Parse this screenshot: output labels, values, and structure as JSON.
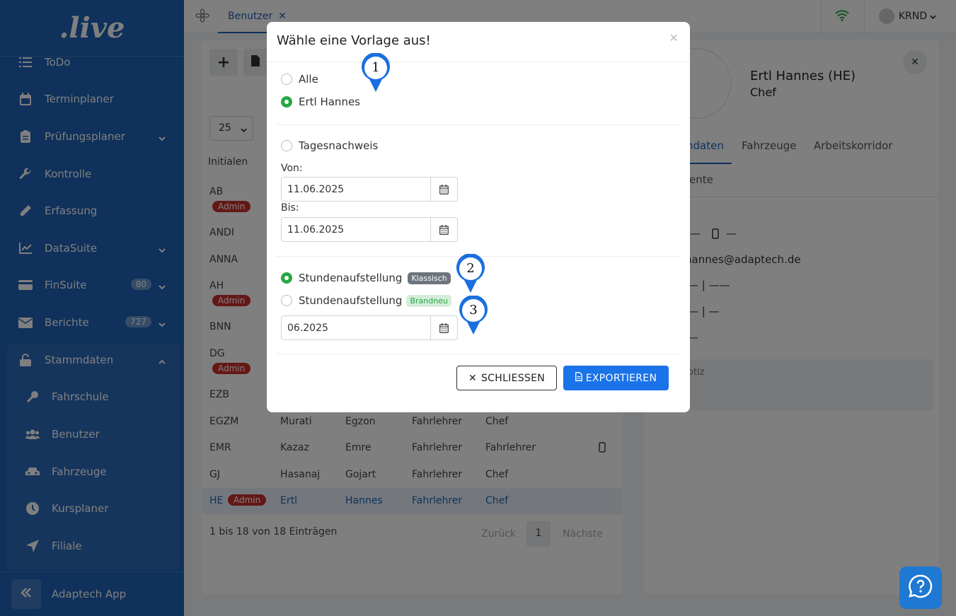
{
  "sidebar": {
    "logo": ".live",
    "items": [
      {
        "label": "ToDo",
        "icon": "list-icon"
      },
      {
        "label": "Terminplaner",
        "icon": "calendar-icon"
      },
      {
        "label": "Prüfungsplaner",
        "icon": "clipboard-icon"
      },
      {
        "label": "Kontrolle",
        "icon": "wrench-icon"
      },
      {
        "label": "Erfassung",
        "icon": "pencil-icon"
      },
      {
        "label": "DataSuite",
        "icon": "chart-line-icon"
      },
      {
        "label": "FinSuite",
        "icon": "card-icon",
        "badge": "80"
      },
      {
        "label": "Berichte",
        "icon": "envelope-icon",
        "badge": "727"
      },
      {
        "label": "Stammdaten",
        "icon": "lock-open-icon"
      }
    ],
    "sub_items": [
      {
        "label": "Fahrschule",
        "icon": "key-icon"
      },
      {
        "label": "Benutzer",
        "icon": "users-icon"
      },
      {
        "label": "Fahrzeuge",
        "icon": "car-icon"
      },
      {
        "label": "Kursplaner",
        "icon": "clock-icon"
      },
      {
        "label": "Filiale",
        "icon": "location-arrow-icon"
      }
    ],
    "footer_label": "Adaptech App"
  },
  "topbar": {
    "tab_label": "Benutzer",
    "user_label": "KRND"
  },
  "table": {
    "page_size": "25",
    "header_initials": "Initialen",
    "rows": [
      {
        "initials": "AB",
        "admin": "Admin"
      },
      {
        "initials": "ANDI"
      },
      {
        "initials": "ANNA"
      },
      {
        "initials": "AH",
        "admin": "Admin"
      },
      {
        "initials": "BNN"
      },
      {
        "initials": "DG",
        "admin": "Admin"
      },
      {
        "initials": "EZB"
      },
      {
        "initials": "EGZM",
        "last": "Murati",
        "first": "Egzon",
        "role": "Fahrlehrer",
        "position": "Chef"
      },
      {
        "initials": "EMR",
        "last": "Kazaz",
        "first": "Emre",
        "role": "Fahrlehrer",
        "position": "Fahrlehrer"
      },
      {
        "initials": "GJ",
        "last": "Hasanaj",
        "first": "Gojart",
        "role": "Fahrlehrer",
        "position": "Chef"
      },
      {
        "initials": "HE",
        "admin": "Admin",
        "last": "Ertl",
        "first": "Hannes",
        "role": "Fahrlehrer",
        "position": "Chef"
      }
    ],
    "footer_info": "1 bis 18 von 18 Einträgen",
    "prev_label": "Zurück",
    "page_number": "1",
    "next_label": "Nächste"
  },
  "detail": {
    "name": "Ertl Hannes (HE)",
    "role": "Chef",
    "tabs": [
      "ndaten",
      "Fahrzeuge",
      "Arbeitskorridor"
    ],
    "tab2": "ente",
    "dash1": "—",
    "dash2": "—",
    "email": "hannes@adaptech.de",
    "line1": "— | ——",
    "line2": "— | —",
    "line3": "—",
    "note_label": "otiz"
  },
  "modal": {
    "title": "Wähle eine Vorlage aus!",
    "opt_all": "Alle",
    "opt_user": "Ertl Hannes",
    "opt_tages": "Tagesnachweis",
    "label_von": "Von:",
    "von_value": "11.06.2025",
    "label_bis": "Bis:",
    "bis_value": "11.06.2025",
    "opt_stunden1": "Stundenaufstellung",
    "tag_klassisch": "Klassisch",
    "opt_stunden2": "Stundenaufstellung",
    "tag_brandneu": "Brandneu",
    "month_value": "06.2025",
    "close_label": "SCHLIESSEN",
    "export_label": "EXPORTIEREN"
  },
  "markers": [
    "1",
    "2",
    "3"
  ],
  "colors": {
    "primary": "#1f62b6",
    "export_button": "#1a73e8",
    "radio_on": "#28a745",
    "admin_badge": "#c9302c",
    "marker": "#1a6fe0"
  }
}
